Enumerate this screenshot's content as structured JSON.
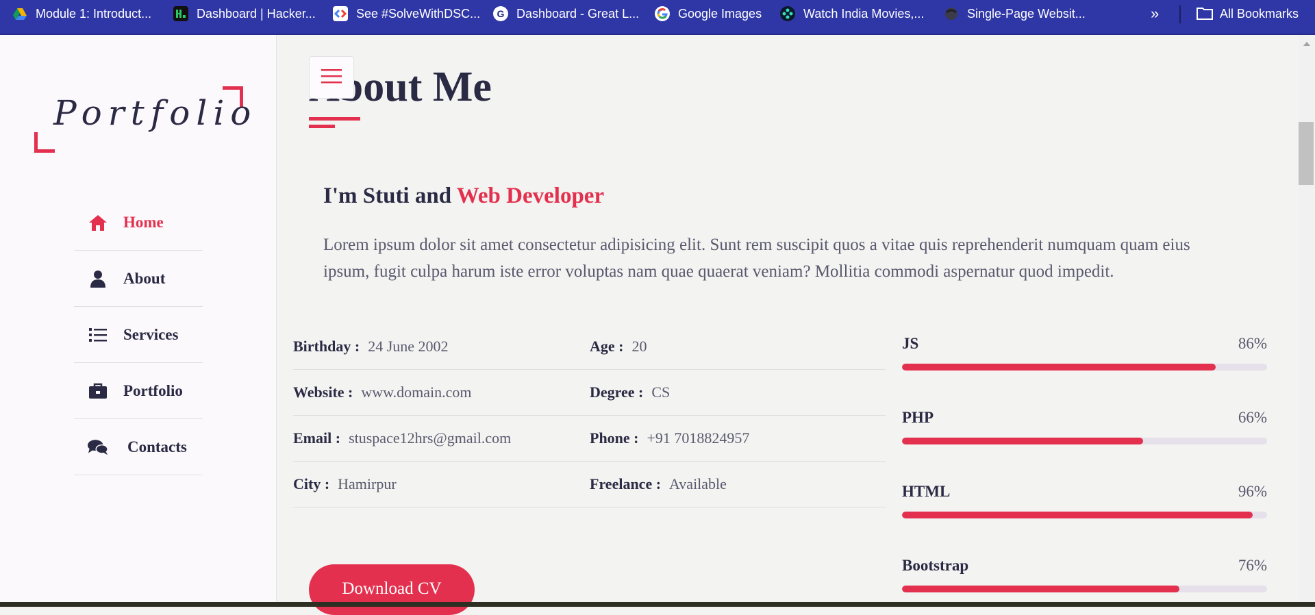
{
  "bookmarks": [
    {
      "label": "Module 1: Introduct...",
      "icon": "google-drive-icon"
    },
    {
      "label": "Dashboard | Hacker...",
      "icon": "hackerrank-icon"
    },
    {
      "label": "See #SolveWithDSC...",
      "icon": "dsc-icon"
    },
    {
      "label": "Dashboard - Great L...",
      "icon": "great-learning-icon"
    },
    {
      "label": "Google Images",
      "icon": "google-icon"
    },
    {
      "label": "Watch India Movies,...",
      "icon": "film-reel-icon"
    },
    {
      "label": "Single-Page Websit...",
      "icon": "website-icon"
    }
  ],
  "bookmarks_overflow": "»",
  "all_bookmarks": "All Bookmarks",
  "logo": "Portfolio",
  "nav": [
    {
      "label": "Home",
      "icon": "home-icon",
      "active": true
    },
    {
      "label": "About",
      "icon": "user-icon",
      "active": false
    },
    {
      "label": "Services",
      "icon": "list-icon",
      "active": false
    },
    {
      "label": "Portfolio",
      "icon": "briefcase-icon",
      "active": false
    },
    {
      "label": "Contacts",
      "icon": "comments-icon",
      "active": false
    }
  ],
  "page_title": "About Me",
  "intro": {
    "prefix": "I'm Stuti and ",
    "highlight": "Web Developer",
    "paragraph": "Lorem ipsum dolor sit amet consectetur adipisicing elit. Sunt rem suscipit quos a vitae quis reprehenderit numquam quam eius ipsum, fugit culpa harum iste error voluptas nam quae quaerat veniam? Mollitia commodi aspernatur quod impedit."
  },
  "info": [
    [
      {
        "key": "Birthday :",
        "value": "24 June 2002"
      },
      {
        "key": "Age :",
        "value": "20"
      }
    ],
    [
      {
        "key": "Website :",
        "value": "www.domain.com"
      },
      {
        "key": "Degree :",
        "value": "CS"
      }
    ],
    [
      {
        "key": "Email :",
        "value": "stuspace12hrs@gmail.com"
      },
      {
        "key": "Phone :",
        "value": "+91 7018824957"
      }
    ],
    [
      {
        "key": "City :",
        "value": "Hamirpur"
      },
      {
        "key": "Freelance :",
        "value": "Available"
      }
    ]
  ],
  "skills": [
    {
      "name": "JS",
      "percent_label": "86%",
      "level": 86
    },
    {
      "name": "PHP",
      "percent_label": "66%",
      "level": 66
    },
    {
      "name": "HTML",
      "percent_label": "96%",
      "level": 96
    },
    {
      "name": "Bootstrap",
      "percent_label": "76%",
      "level": 76
    }
  ],
  "download_button": "Download CV",
  "colors": {
    "accent": "#e3304e",
    "dark": "#2b2a44",
    "bookmark_bar": "#2f36a6"
  }
}
